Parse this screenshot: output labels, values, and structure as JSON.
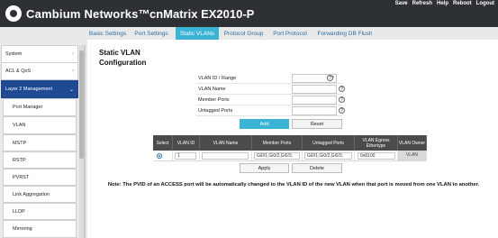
{
  "header": {
    "brand": "Cambium Networks™",
    "model": "cnMatrix EX2010-P",
    "links": [
      "Save",
      "Refresh",
      "Help",
      "Reboot",
      "Logout"
    ]
  },
  "tabs": [
    "Basic Settings",
    "Port Settings",
    "Static VLANs",
    "Protocol Group",
    "Port Protocol",
    "Forwarding DB Flush"
  ],
  "sidebar": {
    "items": [
      "System",
      "ACL & QoS",
      "Layer 2 Management",
      "Port Manager",
      "VLAN",
      "MSTP",
      "RSTP",
      "PVRST",
      "Link Aggregation",
      "LLDP",
      "Mirroring"
    ]
  },
  "page": {
    "title_line1": "Static VLAN",
    "title_line2": "Configuration"
  },
  "form": {
    "vlan_id_label": "VLAN ID / Range",
    "vlan_name_label": "VLAN Name",
    "member_ports_label": "Member Ports",
    "untagged_ports_label": "Untagged Ports",
    "help_glyph": "?",
    "add_label": "Add",
    "reset_label": "Reset"
  },
  "table": {
    "headers": [
      "Select",
      "VLAN ID",
      "VLAN Name",
      "Member Ports",
      "Untagged Ports",
      "VLAN Egress Ethertype",
      "VLAN Owner"
    ],
    "row": {
      "vlan_id": "1",
      "vlan_name": "",
      "member_ports": "Gi0/1,Gi0/2,Gi0/3,",
      "untagged_ports": "Gi0/1,Gi0/2,Gi0/3,",
      "ethertype": "0x8100",
      "owner": "VLAN"
    },
    "apply_label": "Apply",
    "delete_label": "Delete"
  },
  "note": "Note: The PVID of an ACCESS port will be automatically changed to the VLAN ID of the new VLAN when that port is moved from one VLAN to another.",
  "colors": {
    "accent": "#3bb3d5",
    "sidebar_active": "#1f4a93",
    "header": "#2d3034"
  }
}
